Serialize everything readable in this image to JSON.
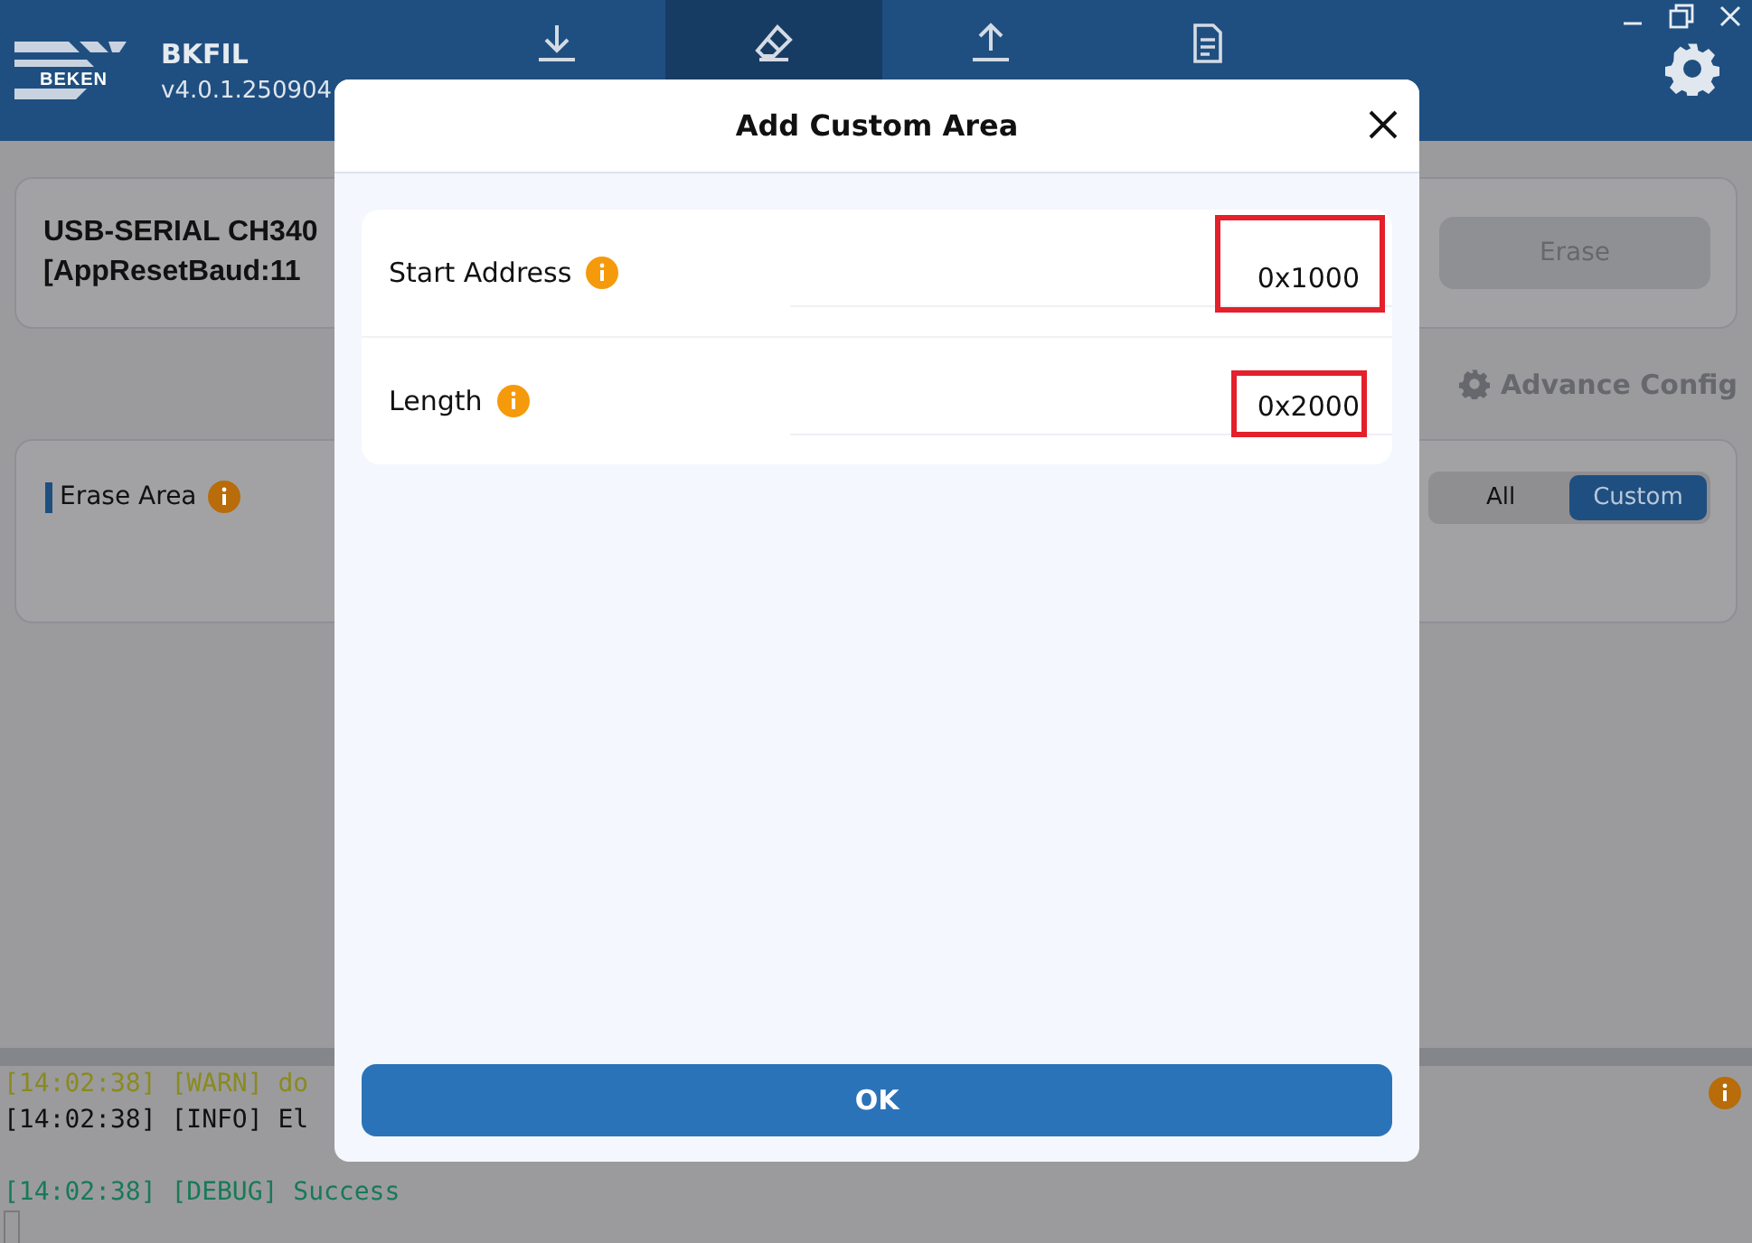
{
  "app": {
    "logo_text": "BEKEN",
    "name": "BKFIL",
    "version": "v4.0.1.250904"
  },
  "toolbar": [
    {
      "kind": "download",
      "selected": false
    },
    {
      "kind": "eraser",
      "selected": true
    },
    {
      "kind": "upload",
      "selected": false
    },
    {
      "kind": "document",
      "selected": false
    }
  ],
  "port": {
    "line_1": "USB-SERIAL CH340",
    "line_2": "[AppResetBaud:11"
  },
  "erase_button": {
    "label": "Erase",
    "disabled": true
  },
  "advance_config": "Advance Config",
  "erase_area": {
    "title": "Erase Area",
    "modes": [
      {
        "label": "All",
        "selected": false
      },
      {
        "label": "Custom",
        "selected": true
      }
    ]
  },
  "log": [
    {
      "kind": "warn",
      "text": "[14:02:38] [WARN] do"
    },
    {
      "kind": "info",
      "text": "[14:02:38] [INFO] El"
    },
    {
      "kind": "debug",
      "text": "[14:02:38] [DEBUG] Success"
    }
  ],
  "dialog": {
    "title": "Add Custom Area",
    "fields": [
      {
        "label": "Start Address",
        "value": "0x1000",
        "highlighted": true
      },
      {
        "label": "Length",
        "value": "0x2000",
        "highlighted": true
      }
    ],
    "ok_button": "OK"
  }
}
